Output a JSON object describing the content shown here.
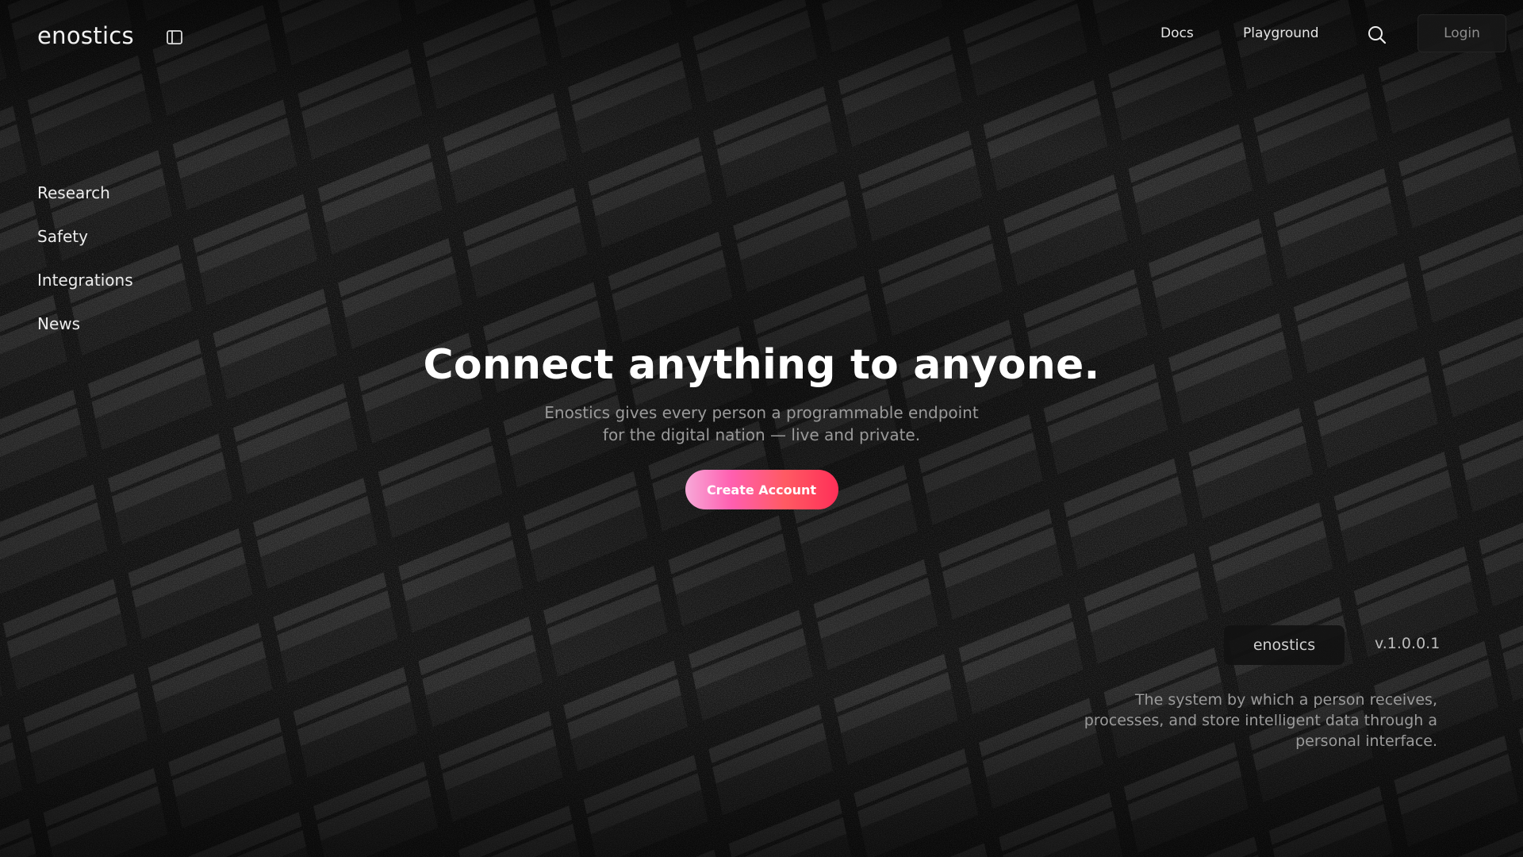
{
  "header": {
    "logo": "enostics",
    "sidebar_toggle_icon": "sidebar-toggle-icon",
    "nav": [
      {
        "label": "Docs"
      },
      {
        "label": "Playground"
      }
    ],
    "search_icon": "search-icon",
    "login_label": "Login"
  },
  "sidebar": {
    "items": [
      {
        "label": "Research"
      },
      {
        "label": "Safety"
      },
      {
        "label": "Integrations"
      },
      {
        "label": "News"
      }
    ]
  },
  "hero": {
    "title": "Connect anything to anyone.",
    "subtitle_line1": "Enostics gives every person a programmable endpoint",
    "subtitle_line2": "for the digital nation — live and private.",
    "cta_label": "Create Account"
  },
  "info": {
    "brand": "enostics",
    "version": "v.1.0.0.1",
    "description": "The system by which a person receives, processes, and store intelligent data through a personal interface."
  },
  "colors": {
    "background": "#0c0c0c",
    "cta_gradient_start": "#f7a9d8",
    "cta_gradient_mid": "#ff5fb0",
    "cta_gradient_end": "#ff2f58"
  }
}
